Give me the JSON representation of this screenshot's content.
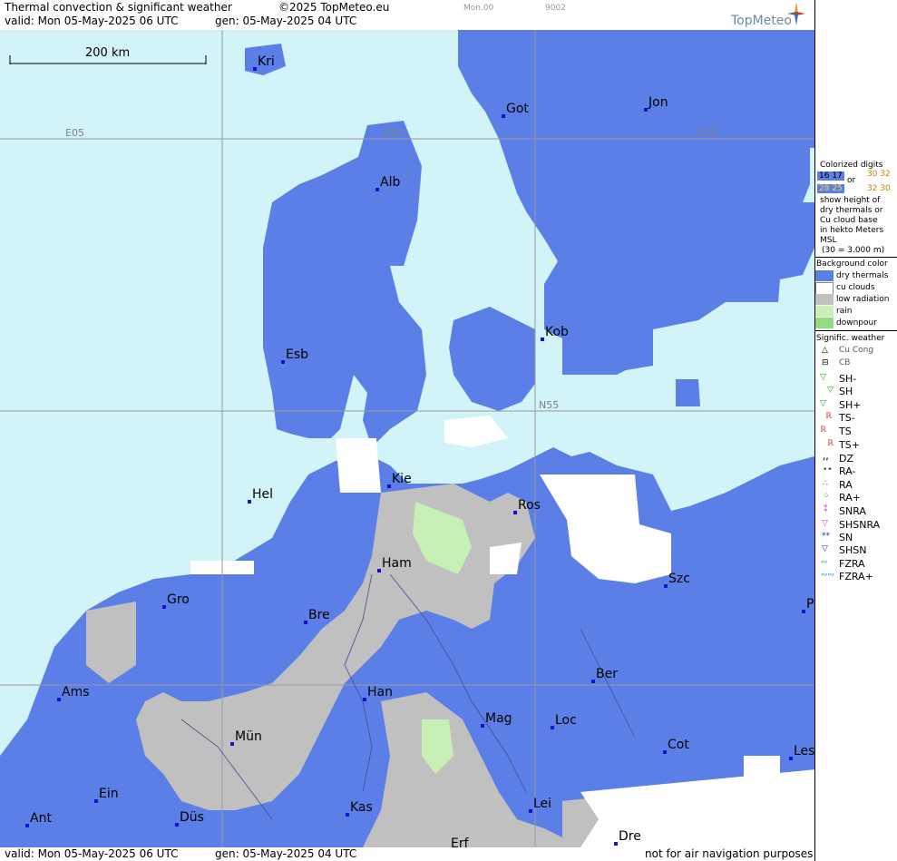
{
  "header": {
    "title": "Thermal convection & significant weather",
    "copyright": "©2025 TopMeteo.eu",
    "valid": "valid:  Mon  05-May-2025  06 UTC",
    "gen": "gen: 05-May-2025 04 UTC",
    "code1": "Mon.00",
    "code2": "9002",
    "brand": "TopMeteo"
  },
  "map": {
    "scale_label": "200 km",
    "grid_labels": [
      "E05",
      "E10",
      "E15",
      "N55"
    ],
    "cities": [
      "Kri",
      "Got",
      "Jon",
      "Alb",
      "Kob",
      "Esb",
      "Kie",
      "Ros",
      "Hel",
      "Ham",
      "Szc",
      "Gro",
      "Bre",
      "Ber",
      "Ams",
      "Han",
      "Mag",
      "Loc",
      "Mün",
      "Cot",
      "Les",
      "Ein",
      "Kas",
      "Lei",
      "Ant",
      "Düs",
      "Dre",
      "Erf",
      "P"
    ]
  },
  "legend": {
    "colorized_title": "Colorized digits",
    "sample_a": "16 17",
    "or": "or",
    "sample_b": "30 32",
    "sample_c": "28 25",
    "sample_d": "32 30",
    "desc1": "show height of",
    "desc2": "dry thermals or",
    "desc3": "Cu cloud base",
    "desc4": "in hekto Meters",
    "desc5": "MSL",
    "desc6": "(30 = 3.000 m)",
    "bg_title": "Background color",
    "bg_items": [
      "dry thermals",
      "cu clouds",
      "low radiation",
      "rain",
      "downpour"
    ],
    "bg_colors": [
      "#5b7fe6",
      "#ffffff",
      "#c0c0c0",
      "#c8f0b4",
      "#90dc82"
    ],
    "wx_title": "Signific. weather",
    "wx_items": [
      "Cu Cong",
      "CB",
      "SH-",
      "SH",
      "SH+",
      "TS-",
      "TS",
      "TS+",
      "DZ",
      "RA-",
      "RA",
      "RA+",
      "SNRA",
      "SHSNRA",
      "SN",
      "SHSN",
      "FZRA",
      "FZRA+"
    ]
  },
  "footer": {
    "valid": "valid:  Mon  05-May-2025  06 UTC",
    "gen": "gen: 05-May-2025 04 UTC",
    "disclaimer": "not for air navigation purposes"
  }
}
